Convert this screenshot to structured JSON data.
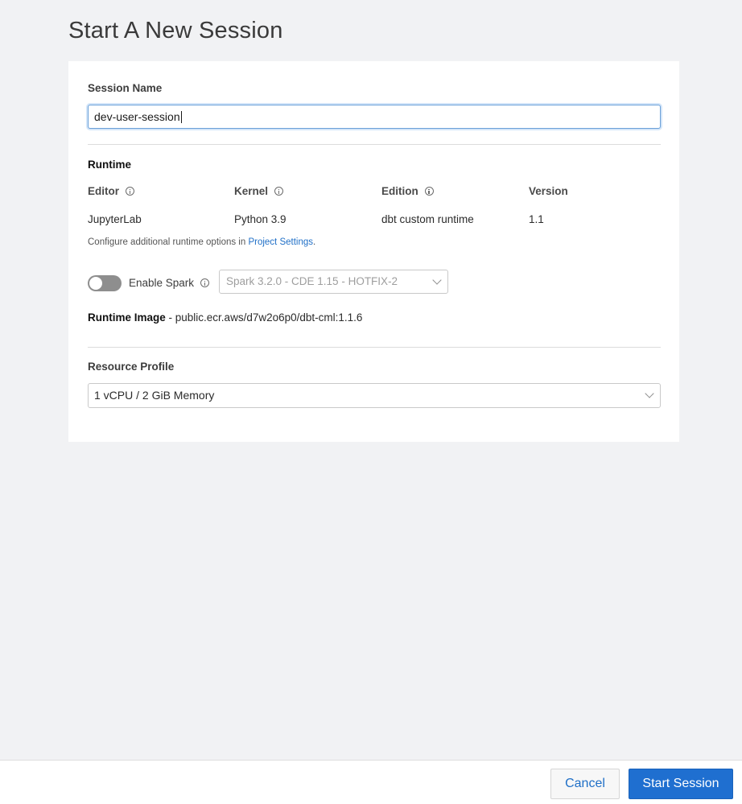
{
  "page": {
    "title": "Start A New Session"
  },
  "session": {
    "name_label": "Session Name",
    "name_value": "dev-user-session"
  },
  "runtime": {
    "section_label": "Runtime",
    "columns": [
      {
        "label": "Editor",
        "value": "JupyterLab",
        "has_info": true
      },
      {
        "label": "Kernel",
        "value": "Python 3.9",
        "has_info": true
      },
      {
        "label": "Edition",
        "value": "dbt custom runtime",
        "has_info": true
      },
      {
        "label": "Version",
        "value": "1.1",
        "has_info": false
      }
    ],
    "help_prefix": "Configure additional runtime options in ",
    "help_link": "Project Settings",
    "help_suffix": ".",
    "spark_toggle_label": "Enable Spark",
    "spark_enabled": false,
    "spark_version_selected": "Spark 3.2.0 - CDE 1.15 - HOTFIX-2",
    "image_label": "Runtime Image",
    "image_value": " - public.ecr.aws/d7w2o6p0/dbt-cml:1.1.6"
  },
  "resource": {
    "label": "Resource Profile",
    "selected": "1 vCPU / 2 GiB Memory"
  },
  "footer": {
    "cancel_label": "Cancel",
    "start_label": "Start Session"
  },
  "colors": {
    "primary": "#1f6fd0",
    "link": "#1f6fc7",
    "background": "#f1f2f4"
  }
}
